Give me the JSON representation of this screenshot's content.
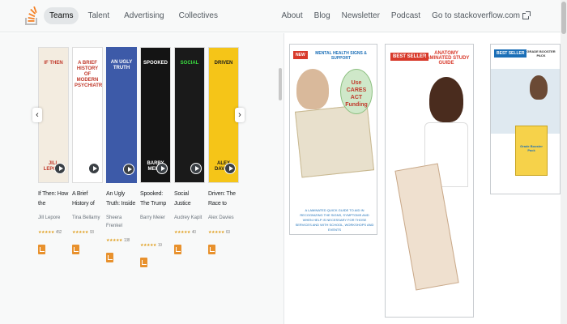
{
  "nav": {
    "left": [
      {
        "label": "Teams",
        "active": true
      },
      {
        "label": "Talent",
        "active": false
      },
      {
        "label": "Advertising",
        "active": false
      },
      {
        "label": "Collectives",
        "active": false
      }
    ],
    "right": [
      {
        "label": "About"
      },
      {
        "label": "Blog"
      },
      {
        "label": "Newsletter"
      },
      {
        "label": "Podcast"
      },
      {
        "label": "Go to stackoverflow.com"
      }
    ]
  },
  "books": [
    {
      "title": "If Then: How the Simulmatics...",
      "author": "Jill Lepore",
      "cover_text": "IF THEN",
      "cover_author": "JILL LEPORE",
      "stars": "★★★★★",
      "rating": "452",
      "color": "#f3ece0",
      "accent": "#c0392b"
    },
    {
      "title": "A Brief History of Modern Psycho...",
      "author": "Tina Bellamy",
      "cover_text": "A BRIEF HISTORY OF MODERN PSYCHIATRY",
      "cover_author": "",
      "stars": "★★★★★",
      "rating": "93",
      "color": "#ffffff",
      "accent": "#c0392b"
    },
    {
      "title": "An Ugly Truth: Inside Facebook's Battle for...",
      "author": "Sheera Frenkel",
      "cover_text": "AN UGLY TRUTH",
      "cover_author": "",
      "stars": "★★★★★",
      "rating": "138",
      "color": "#3d5aa8",
      "accent": "#ffffff"
    },
    {
      "title": "Spooked: The Trump Dossier, Black Cube, a...",
      "author": "Barry Meier",
      "cover_text": "SPOOKED",
      "cover_author": "BARRY MEIER",
      "stars": "★★★★★",
      "rating": "19",
      "color": "#141414",
      "accent": "#ffffff"
    },
    {
      "title": "Social Justice Sources from the Worldwide...",
      "author": "Audrey Kapit",
      "cover_text": "SOCIAL",
      "cover_author": "",
      "stars": "★★★★★",
      "rating": "40",
      "color": "#1a1a1a",
      "accent": "#3ae040"
    },
    {
      "title": "Driven: The Race to Create the Autonom...",
      "author": "Alex Davies",
      "cover_text": "DRIVEN",
      "cover_author": "ALEX DAVIES",
      "stars": "★★★★★",
      "rating": "63",
      "color": "#f5c518",
      "accent": "#1a1a1a"
    }
  ],
  "ads": [
    {
      "badge": "NEW",
      "headline": "MENTAL HEALTH SIGNS & SUPPORT",
      "callout": "Use CARES ACT Funding",
      "caption": "A LAMINATED QUICK GUIDE TO AID IN RECOGNIZING THE SIGNS, SYMPTOMS AND WHEN HELP IS NECESSARY FOR THOSE SERVICES AND WITH SCHOOL, WORKSHOPS AND EVENTS"
    },
    {
      "badge": "BEST SELLER",
      "headline": "ANATOMY LAMINATED STUDY GUIDE"
    },
    {
      "badge": "BEST SELLER",
      "headline": "GRADE BOOSTER PACK",
      "sub": "Grade Booster Pack"
    }
  ],
  "colors": {
    "accent": "#f48024",
    "prime": "#e8912d",
    "badge_blue": "#1b6fb7",
    "badge_red": "#d83a2b"
  }
}
